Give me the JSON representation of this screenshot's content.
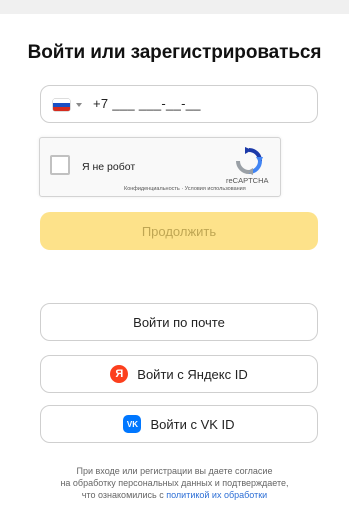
{
  "title": "Войти или зарегистрироваться",
  "phone": {
    "country_flag": "flag-ru-icon",
    "value": "+7 ___ ___-__-__"
  },
  "captcha": {
    "label": "Я не робот",
    "brand": "reCAPTCHA",
    "links": "Конфиденциальность · Условия использования"
  },
  "continue_label": "Продолжить",
  "login_mail_label": "Войти по почте",
  "login_yandex": {
    "icon_letter": "Я",
    "label": "Войти с Яндекс ID"
  },
  "login_vk": {
    "icon_letter": "VK",
    "label": "Войти с VK ID"
  },
  "legal": {
    "line1": "При входе или регистрации вы даете согласие",
    "line2": "на обработку персональных данных и подтверждаете,",
    "line3_prefix": "что ознакомились с ",
    "link": "политикой их обработки"
  },
  "colors": {
    "continue_bg": "#fde28a",
    "continue_text": "#bfa653",
    "yandex": "#fc3f1d",
    "vk": "#0077ff",
    "link": "#2d6fd6"
  }
}
